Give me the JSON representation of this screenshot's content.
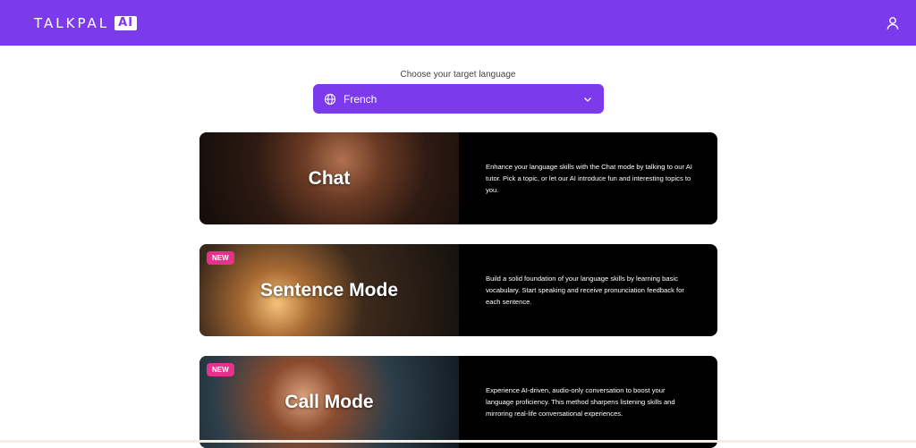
{
  "header": {
    "logo_text": "TALKPAL",
    "logo_badge": "AI",
    "user_icon": "user-icon"
  },
  "language_picker": {
    "label": "Choose your target language",
    "selected": "French",
    "icon": "globe-icon",
    "chevron": "chevron-down-icon"
  },
  "modes": [
    {
      "title": "Chat",
      "badge": "",
      "description": "Enhance your language skills with the Chat mode by talking to our AI tutor. Pick a topic, or let our AI introduce fun and interesting topics to you."
    },
    {
      "title": "Sentence Mode",
      "badge": "NEW",
      "description": "Build a solid foundation of your language skills by learning basic vocabulary. Start speaking and receive pronunciation feedback for each sentence."
    },
    {
      "title": "Call Mode",
      "badge": "NEW",
      "description": "Experience AI-driven, audio-only conversation to boost your language proficiency. This method sharpens listening skills and mirroring real-life conversational experiences."
    }
  ],
  "colors": {
    "brand": "#7c3aed",
    "badge": "#e5318b",
    "card_bg": "#000000"
  }
}
